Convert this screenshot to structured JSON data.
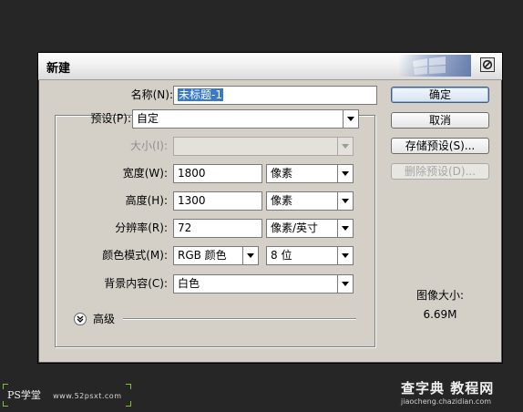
{
  "dialog": {
    "title": "新建",
    "fields": {
      "name": {
        "label": "名称(N):",
        "value": "未标题-1"
      },
      "preset": {
        "label": "预设(P):",
        "value": "自定"
      },
      "size": {
        "label": "大小(I):",
        "value": ""
      },
      "width": {
        "label": "宽度(W):",
        "value": "1800",
        "unit": "像素"
      },
      "height": {
        "label": "高度(H):",
        "value": "1300",
        "unit": "像素"
      },
      "resolution": {
        "label": "分辨率(R):",
        "value": "72",
        "unit": "像素/英寸"
      },
      "color_mode": {
        "label": "颜色模式(M):",
        "value": "RGB 颜色",
        "depth": "8 位"
      },
      "background": {
        "label": "背景内容(C):",
        "value": "白色"
      }
    },
    "advanced_label": "高级",
    "buttons": {
      "ok": "确定",
      "cancel": "取消",
      "save_preset": "存储预设(S)...",
      "delete_preset": "删除预设(D)..."
    },
    "image_size": {
      "label": "图像大小:",
      "value": "6.69M"
    }
  },
  "watermarks": {
    "left_brand": "PS学堂",
    "left_url": "www.52psxt.com",
    "right_brand": "查字典 教程网",
    "right_domain": "jiaocheng.chazidian.com"
  },
  "colors": {
    "background": "#262626",
    "dialog": "#d4d0c8",
    "selection": "#3a78c8"
  }
}
